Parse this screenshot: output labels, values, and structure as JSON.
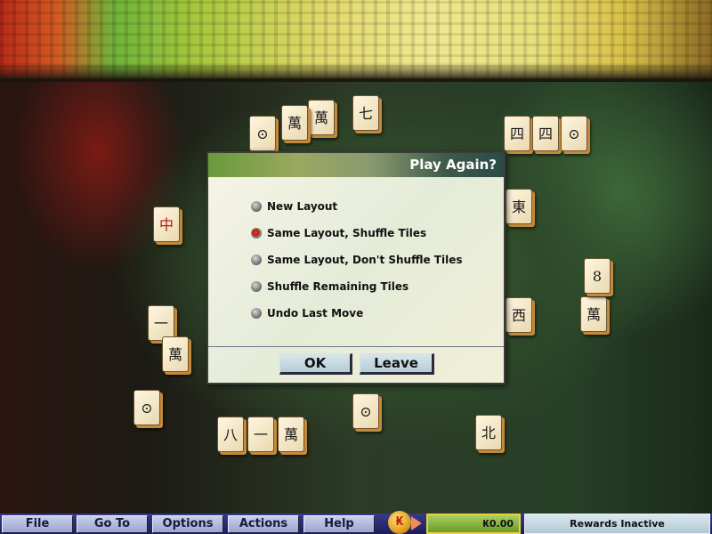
{
  "tiles": [
    "七",
    "四",
    "四",
    "⊙",
    "萬",
    "萬",
    "⊙",
    "中",
    "一",
    "萬",
    "東",
    "西",
    "萬",
    "八",
    "一",
    "萬",
    "⊙",
    "北",
    "8",
    "⊙"
  ],
  "dialog": {
    "title": "Play Again?",
    "options": [
      {
        "label": "New Layout",
        "selected": false
      },
      {
        "label": "Same Layout, Shuffle Tiles",
        "selected": true
      },
      {
        "label": "Same Layout, Don't Shuffle Tiles",
        "selected": false
      },
      {
        "label": "Shuffle Remaining Tiles",
        "selected": false
      },
      {
        "label": "Undo Last Move",
        "selected": false
      }
    ],
    "ok_label": "OK",
    "leave_label": "Leave"
  },
  "menubar": {
    "items": [
      "File",
      "Go To",
      "Options",
      "Actions",
      "Help"
    ],
    "coin_symbol": "₭",
    "balance": "₭0.00",
    "rewards": "Rewards Inactive"
  }
}
